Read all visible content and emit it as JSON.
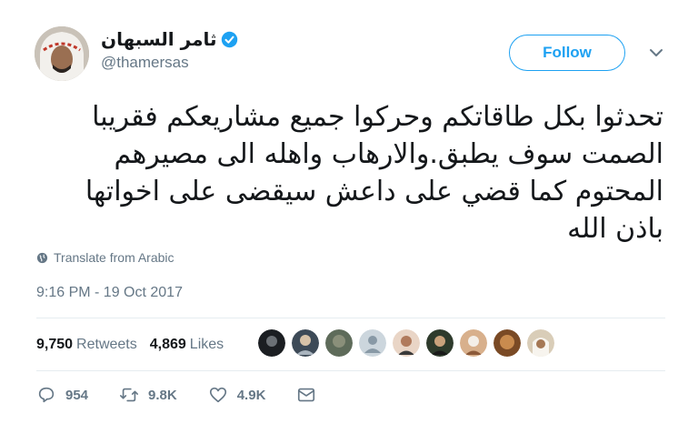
{
  "author": {
    "display_name": "ثامر السبهان",
    "handle": "@thamersas",
    "verified": true
  },
  "follow_button": {
    "label": "Follow"
  },
  "tweet": {
    "text": "تحدثوا بكل طاقاتكم وحركوا جميع مشاريعكم فقريبا الصمت سوف يطبق.والارهاب واهله الى مصيرهم المحتوم كما قضي على داعش سيقضى على اخواتها باذن الله",
    "translate_label": "Translate from Arabic",
    "timestamp": "9:16 PM - 19 Oct 2017"
  },
  "stats": {
    "retweets_count": "9,750",
    "retweets_label": "Retweets",
    "likes_count": "4,869",
    "likes_label": "Likes"
  },
  "actions": {
    "replies": "954",
    "retweets": "9.8K",
    "likes": "4.9K"
  },
  "colors": {
    "accent": "#1da1f2",
    "muted": "#657786",
    "divider": "#e6ecf0"
  }
}
